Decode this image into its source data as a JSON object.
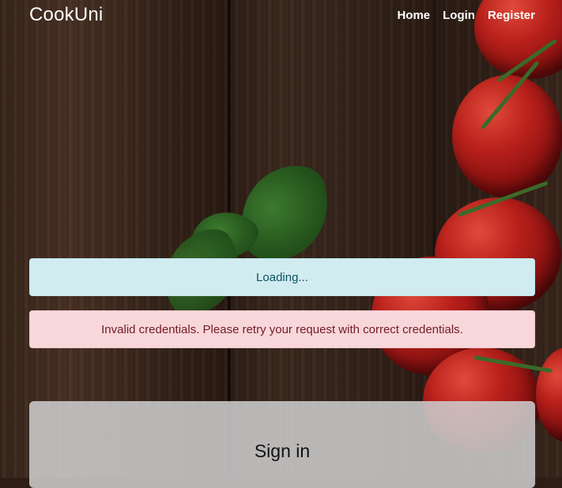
{
  "navbar": {
    "brand": "CookUni",
    "links": [
      {
        "label": "Home"
      },
      {
        "label": "Login"
      },
      {
        "label": "Register"
      }
    ]
  },
  "alerts": {
    "loading": "Loading...",
    "error": "Invalid credentials. Please retry your request with correct credentials."
  },
  "form": {
    "title": "Sign in"
  },
  "colors": {
    "info_bg": "#d1ecf1",
    "info_text": "#0c5460",
    "danger_bg": "#f8d7da",
    "danger_text": "#721c24",
    "card_bg": "#cccccc"
  }
}
